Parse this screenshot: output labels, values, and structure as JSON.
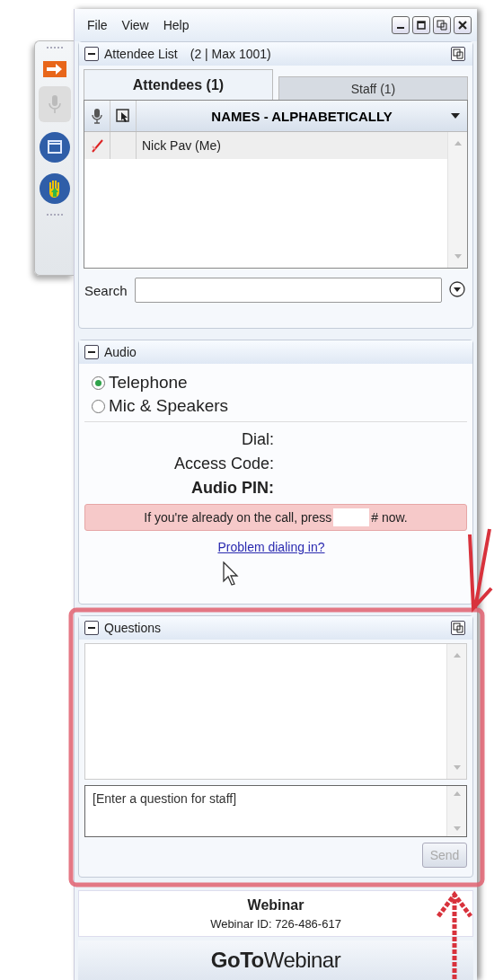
{
  "menu": [
    "File",
    "View",
    "Help"
  ],
  "attendee_list": {
    "title": "Attendee List",
    "count": "(2 | Max 1001)",
    "tabs": [
      {
        "label": "Attendees (1)",
        "selected": true
      },
      {
        "label": "Staff (1)",
        "selected": false
      }
    ],
    "sort_label": "NAMES - ALPHABETICALLY",
    "rows": [
      {
        "name": "Nick Pav (Me)",
        "muted": true
      }
    ],
    "search": {
      "label": "Search"
    }
  },
  "audio": {
    "title": "Audio",
    "options": [
      {
        "label": "Telephone",
        "selected": true
      },
      {
        "label": "Mic & Speakers",
        "selected": false
      }
    ],
    "fields": [
      {
        "label": "Dial:",
        "emphasized": false
      },
      {
        "label": "Access Code:",
        "emphasized": false
      },
      {
        "label": "Audio PIN:",
        "emphasized": true
      }
    ],
    "notice": [
      "If you're already on the call, press",
      "# now."
    ],
    "link": "Problem dialing in?"
  },
  "questions": {
    "title": "Questions",
    "placeholder": "[Enter a question for staff]",
    "send": {
      "label": "Send",
      "disabled": true
    }
  },
  "footer": {
    "title": "Webinar",
    "webinar_id": "Webinar ID: 726-486-617",
    "logo": "**GoTo**Webinar"
  }
}
